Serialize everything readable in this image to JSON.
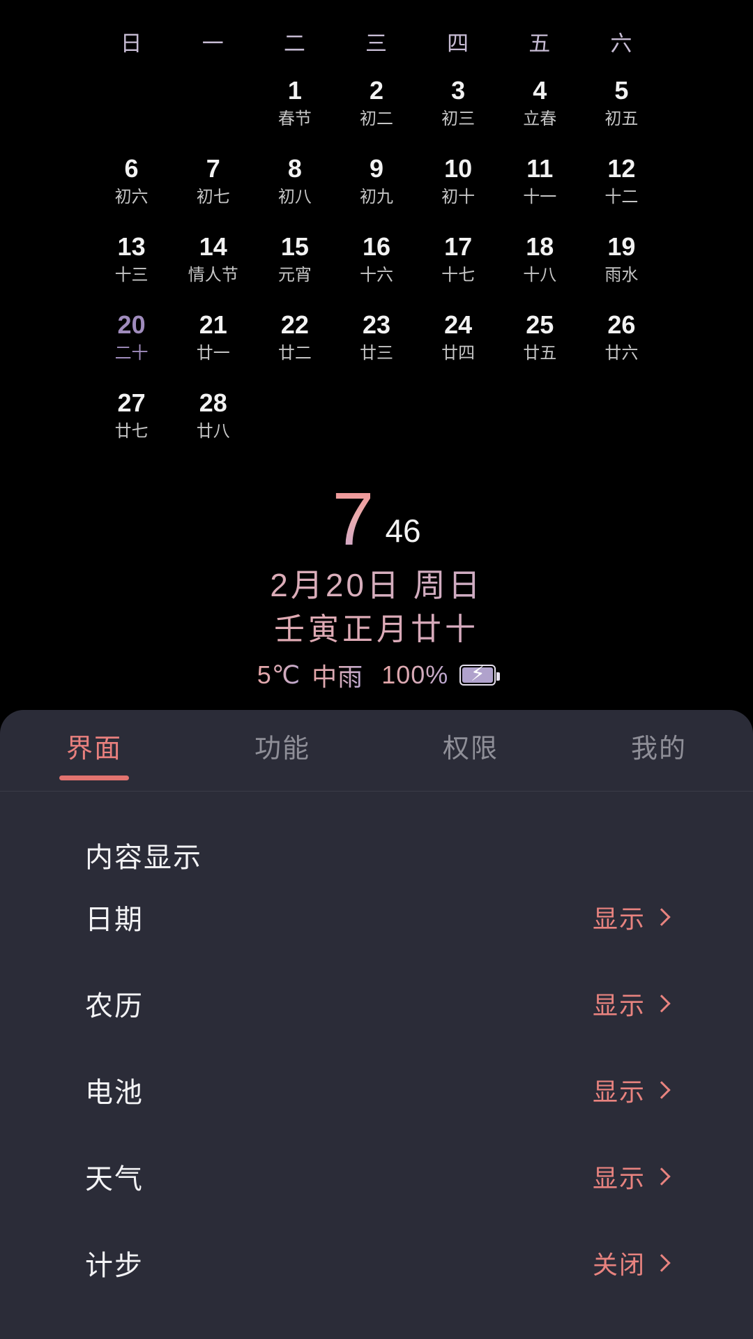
{
  "calendar": {
    "weekdays": [
      "日",
      "一",
      "二",
      "三",
      "四",
      "五",
      "六"
    ],
    "lead_blanks": 2,
    "days": [
      {
        "num": "1",
        "lunar": "春节",
        "today": false
      },
      {
        "num": "2",
        "lunar": "初二",
        "today": false
      },
      {
        "num": "3",
        "lunar": "初三",
        "today": false
      },
      {
        "num": "4",
        "lunar": "立春",
        "today": false
      },
      {
        "num": "5",
        "lunar": "初五",
        "today": false
      },
      {
        "num": "6",
        "lunar": "初六",
        "today": false
      },
      {
        "num": "7",
        "lunar": "初七",
        "today": false
      },
      {
        "num": "8",
        "lunar": "初八",
        "today": false
      },
      {
        "num": "9",
        "lunar": "初九",
        "today": false
      },
      {
        "num": "10",
        "lunar": "初十",
        "today": false
      },
      {
        "num": "11",
        "lunar": "十一",
        "today": false
      },
      {
        "num": "12",
        "lunar": "十二",
        "today": false
      },
      {
        "num": "13",
        "lunar": "十三",
        "today": false
      },
      {
        "num": "14",
        "lunar": "情人节",
        "today": false
      },
      {
        "num": "15",
        "lunar": "元宵",
        "today": false
      },
      {
        "num": "16",
        "lunar": "十六",
        "today": false
      },
      {
        "num": "17",
        "lunar": "十七",
        "today": false
      },
      {
        "num": "18",
        "lunar": "十八",
        "today": false
      },
      {
        "num": "19",
        "lunar": "雨水",
        "today": false
      },
      {
        "num": "20",
        "lunar": "二十",
        "today": true
      },
      {
        "num": "21",
        "lunar": "廿一",
        "today": false
      },
      {
        "num": "22",
        "lunar": "廿二",
        "today": false
      },
      {
        "num": "23",
        "lunar": "廿三",
        "today": false
      },
      {
        "num": "24",
        "lunar": "廿四",
        "today": false
      },
      {
        "num": "25",
        "lunar": "廿五",
        "today": false
      },
      {
        "num": "26",
        "lunar": "廿六",
        "today": false
      },
      {
        "num": "27",
        "lunar": "廿七",
        "today": false
      },
      {
        "num": "28",
        "lunar": "廿八",
        "today": false
      }
    ],
    "today_color": "#a08cbd",
    "weekday_color": "#c7bcd4"
  },
  "clock": {
    "hour": "7",
    "minute": "46",
    "date_line": "2月20日 周日",
    "lunar_line": "壬寅正月廿十",
    "temperature": "5℃",
    "weather": "中雨",
    "battery_percent": "100%",
    "battery_icon": "charging-battery-icon",
    "bolt_glyph": "⚡",
    "accent_pink": "#ec9a9c",
    "accent_purple": "#b9a8d4"
  },
  "panel": {
    "tabs": [
      {
        "label": "界面",
        "active": true
      },
      {
        "label": "功能",
        "active": false
      },
      {
        "label": "权限",
        "active": false
      },
      {
        "label": "我的",
        "active": false
      }
    ],
    "active_tab_color": "#e9807e",
    "section_title": "内容显示",
    "rows": [
      {
        "key": "日期",
        "value": "显示"
      },
      {
        "key": "农历",
        "value": "显示"
      },
      {
        "key": "电池",
        "value": "显示"
      },
      {
        "key": "天气",
        "value": "显示"
      },
      {
        "key": "计步",
        "value": "关闭"
      }
    ],
    "background": "#2b2c38",
    "value_color": "#e8837f"
  }
}
